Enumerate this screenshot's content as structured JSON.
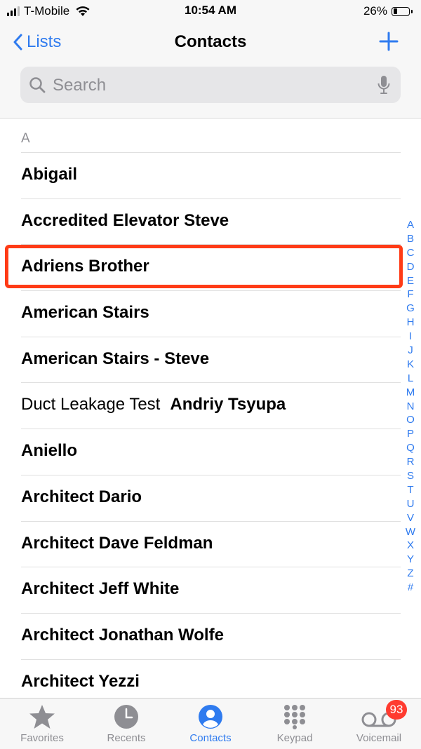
{
  "status_bar": {
    "carrier": "T-Mobile",
    "time": "10:54 AM",
    "battery": "26%",
    "battery_level": 0.26
  },
  "nav": {
    "back_label": "Lists",
    "title": "Contacts"
  },
  "search": {
    "placeholder": "Search"
  },
  "section": {
    "letter": "A"
  },
  "contacts": [
    {
      "prefix": "",
      "name": "Abigail"
    },
    {
      "prefix": "",
      "name": "Accredited Elevator Steve"
    },
    {
      "prefix": "",
      "name": "Adriens Brother"
    },
    {
      "prefix": "",
      "name": "American Stairs"
    },
    {
      "prefix": "",
      "name": "American Stairs - Steve"
    },
    {
      "prefix": "Duct Leakage Test",
      "name": "Andriy Tsyupa"
    },
    {
      "prefix": "",
      "name": "Aniello"
    },
    {
      "prefix": "",
      "name": "Architect Dario"
    },
    {
      "prefix": "",
      "name": "Architect Dave Feldman"
    },
    {
      "prefix": "",
      "name": "Architect Jeff White"
    },
    {
      "prefix": "",
      "name": "Architect Jonathan Wolfe"
    },
    {
      "prefix": "",
      "name": "Architect Yezzi"
    }
  ],
  "index": [
    "A",
    "B",
    "C",
    "D",
    "E",
    "F",
    "G",
    "H",
    "I",
    "J",
    "K",
    "L",
    "M",
    "N",
    "O",
    "P",
    "Q",
    "R",
    "S",
    "T",
    "U",
    "V",
    "W",
    "X",
    "Y",
    "Z",
    "#"
  ],
  "tabs": [
    {
      "label": "Favorites",
      "icon": "star-icon"
    },
    {
      "label": "Recents",
      "icon": "clock-icon"
    },
    {
      "label": "Contacts",
      "icon": "person-circle-icon",
      "active": true
    },
    {
      "label": "Keypad",
      "icon": "keypad-icon"
    },
    {
      "label": "Voicemail",
      "icon": "voicemail-icon",
      "badge": "93"
    }
  ],
  "colors": {
    "accent": "#2f7bef",
    "highlight": "#ff3b16",
    "badge": "#ff3b30"
  }
}
